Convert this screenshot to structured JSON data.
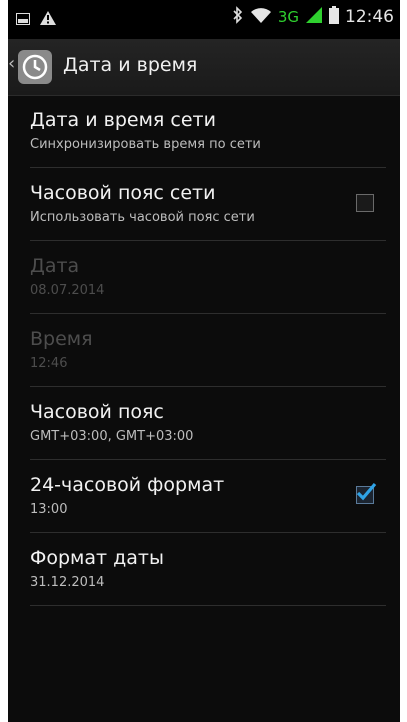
{
  "status_bar": {
    "time": "12:46",
    "network": "3G",
    "icons": [
      "screenshot-icon",
      "warning-icon",
      "bluetooth-icon",
      "wifi-icon",
      "signal-icon",
      "battery-icon"
    ]
  },
  "action_bar": {
    "title": "Дата и время",
    "icon": "clock-icon"
  },
  "settings": [
    {
      "title": "Дата и время сети",
      "subtitle": "Синхронизировать время по сети",
      "enabled": true,
      "checkbox": null
    },
    {
      "title": "Часовой пояс сети",
      "subtitle": "Использовать часовой пояс сети",
      "enabled": true,
      "checkbox": "unchecked"
    },
    {
      "title": "Дата",
      "subtitle": "08.07.2014",
      "enabled": false,
      "checkbox": null
    },
    {
      "title": "Время",
      "subtitle": "12:46",
      "enabled": false,
      "checkbox": null
    },
    {
      "title": "Часовой пояс",
      "subtitle": "GMT+03:00, GMT+03:00",
      "enabled": true,
      "checkbox": null
    },
    {
      "title": "24-часовой формат",
      "subtitle": "13:00",
      "enabled": true,
      "checkbox": "checked"
    },
    {
      "title": "Формат даты",
      "subtitle": "31.12.2014",
      "enabled": true,
      "checkbox": null
    }
  ],
  "colors": {
    "background": "#0c0c0c",
    "check_accent": "#2fa3e6",
    "signal_green": "#2fd02f"
  }
}
